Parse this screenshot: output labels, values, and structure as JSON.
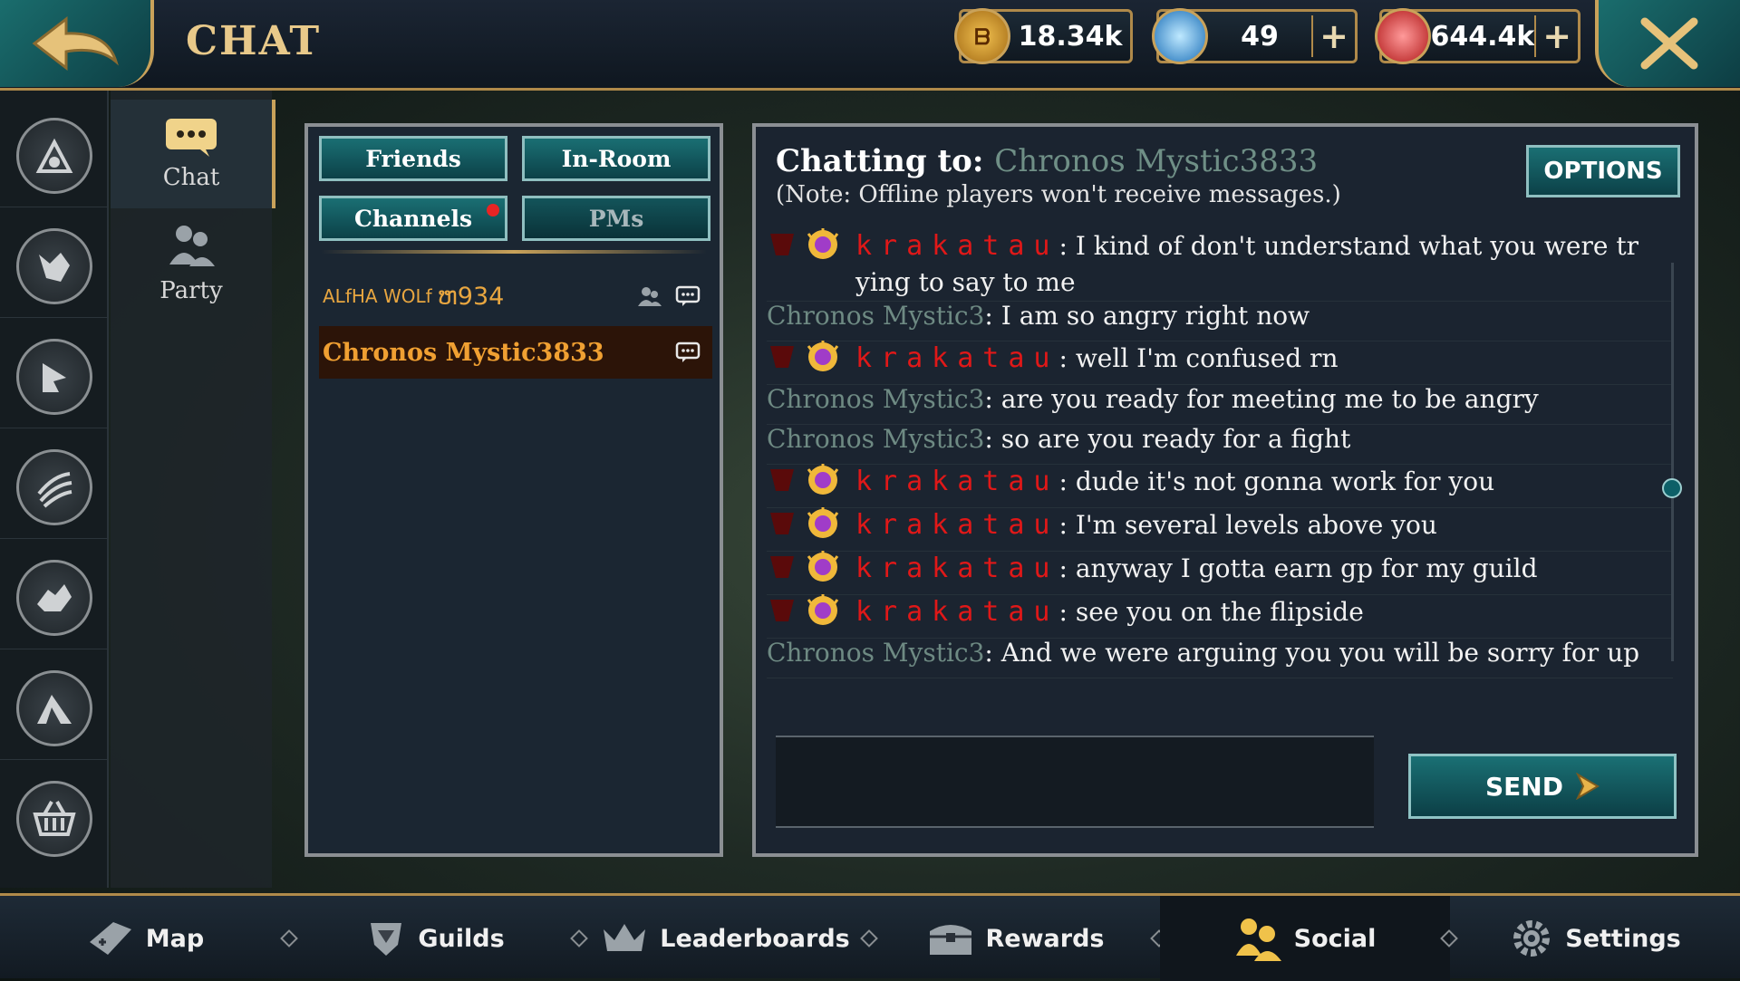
{
  "header": {
    "title": "CHAT"
  },
  "currencies": [
    {
      "name": "gp",
      "value": "18.34k",
      "icon": "gold-coin-icon",
      "has_plus": false
    },
    {
      "name": "gems",
      "value": "49",
      "icon": "blue-gem-icon",
      "has_plus": true
    },
    {
      "name": "rubies",
      "value": "644.4k",
      "icon": "red-ruby-icon",
      "has_plus": true
    }
  ],
  "sub_nav": {
    "chat": "Chat",
    "party": "Party"
  },
  "tabs": {
    "friends": "Friends",
    "in_room": "In-Room",
    "channels": "Channels",
    "pms": "PMs"
  },
  "contacts": [
    {
      "name": "ALfHA WOLf",
      "suffix": "ຫ934",
      "selected": false
    },
    {
      "name": "Chronos Mystic3833",
      "selected": true
    }
  ],
  "chat": {
    "label": "Chatting to:",
    "target": "Chronos Mystic3833",
    "note": "(Note: Offline players won't receive messages.)",
    "options_label": "OPTIONS",
    "send_label": "SEND",
    "messages": [
      {
        "sender": "krakatau",
        "text": ": I kind of don't understand what you were tr",
        "text2": "ying to say to me"
      },
      {
        "sender": "Chronos Mystic3",
        "text": ": I am so angry right now"
      },
      {
        "sender": "krakatau",
        "text": ": well I'm confused rn"
      },
      {
        "sender": "Chronos Mystic3",
        "text": ": are you ready for meeting me to be angry"
      },
      {
        "sender": "Chronos Mystic3",
        "text": ": so are you ready for a fight"
      },
      {
        "sender": "krakatau",
        "text": ": dude it's not gonna work for you"
      },
      {
        "sender": "krakatau",
        "text": ": I'm several levels above you"
      },
      {
        "sender": "krakatau",
        "text": ": anyway I gotta earn gp for my guild"
      },
      {
        "sender": "krakatau",
        "text": ": see you on the flipside"
      },
      {
        "sender": "Chronos Mystic3",
        "text": ": And we were arguing you you will be sorry for up"
      }
    ]
  },
  "bottom_nav": {
    "map": "Map",
    "guilds": "Guilds",
    "leaderboards": "Leaderboards",
    "rewards": "Rewards",
    "social": "Social",
    "settings": "Settings"
  }
}
